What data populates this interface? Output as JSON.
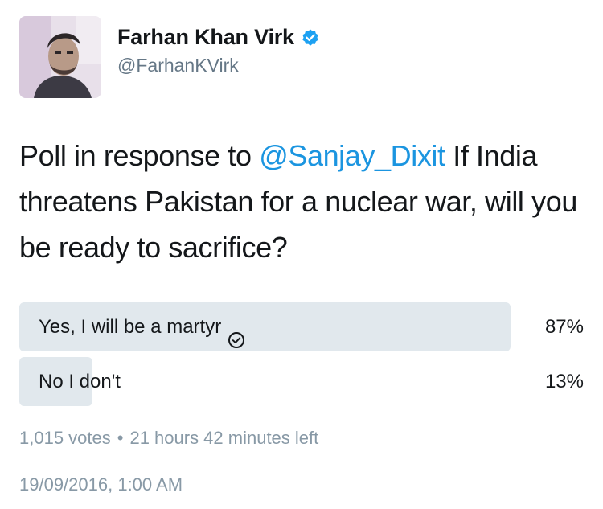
{
  "user": {
    "display_name": "Farhan Khan Virk",
    "handle": "@FarhanKVirk",
    "verified": true,
    "verified_icon": "verified-badge-icon",
    "verified_color": "#1da1f2"
  },
  "tweet": {
    "text_before": "Poll in response to ",
    "mention": "@Sanjay_Dixit",
    "text_after": " If India threatens Pakistan for a nuclear war, will you be ready to sacrifice?",
    "mention_color": "#1b95e0"
  },
  "poll": {
    "options": [
      {
        "label": "Yes, I will be a martyr",
        "percent": "87%",
        "share": 0.87,
        "selected": true,
        "icon": "check-circle-icon"
      },
      {
        "label": "No I don't",
        "percent": "13%",
        "share": 0.13,
        "selected": false
      }
    ],
    "votes": "1,015 votes",
    "separator": "•",
    "time_left": "21 hours 42 minutes left",
    "bar_color": "#e1e8ed"
  },
  "timestamp": "19/09/2016, 1:00 AM"
}
